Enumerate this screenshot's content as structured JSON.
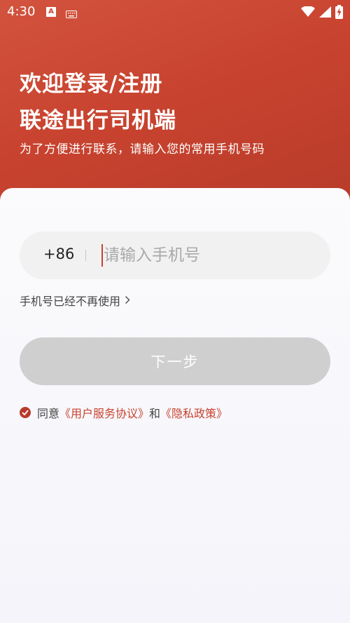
{
  "status_bar": {
    "time": "4:30",
    "left_icons": [
      "a-app-icon",
      "keyboard-icon"
    ],
    "right_icons": [
      "wifi-icon",
      "signal-icon",
      "battery-charging-icon"
    ]
  },
  "hero": {
    "title_line1": "欢迎登录/注册",
    "title_line2": "联途出行司机端",
    "subtitle": "为了方便进行联系，请输入您的常用手机号码"
  },
  "form": {
    "country_code": "+86",
    "phone_placeholder": "请输入手机号",
    "phone_value": "",
    "no_longer_link": "手机号已经不再使用",
    "next_label": "下一步"
  },
  "agreement": {
    "prefix": "同意",
    "user_agreement": "《用户服务协议》",
    "and": "和",
    "privacy_policy": "《隐私政策》",
    "checked": true
  },
  "colors": {
    "brand": "#c8432f",
    "button_disabled": "#cfcfcf",
    "input_bg": "#f1f1f1"
  }
}
